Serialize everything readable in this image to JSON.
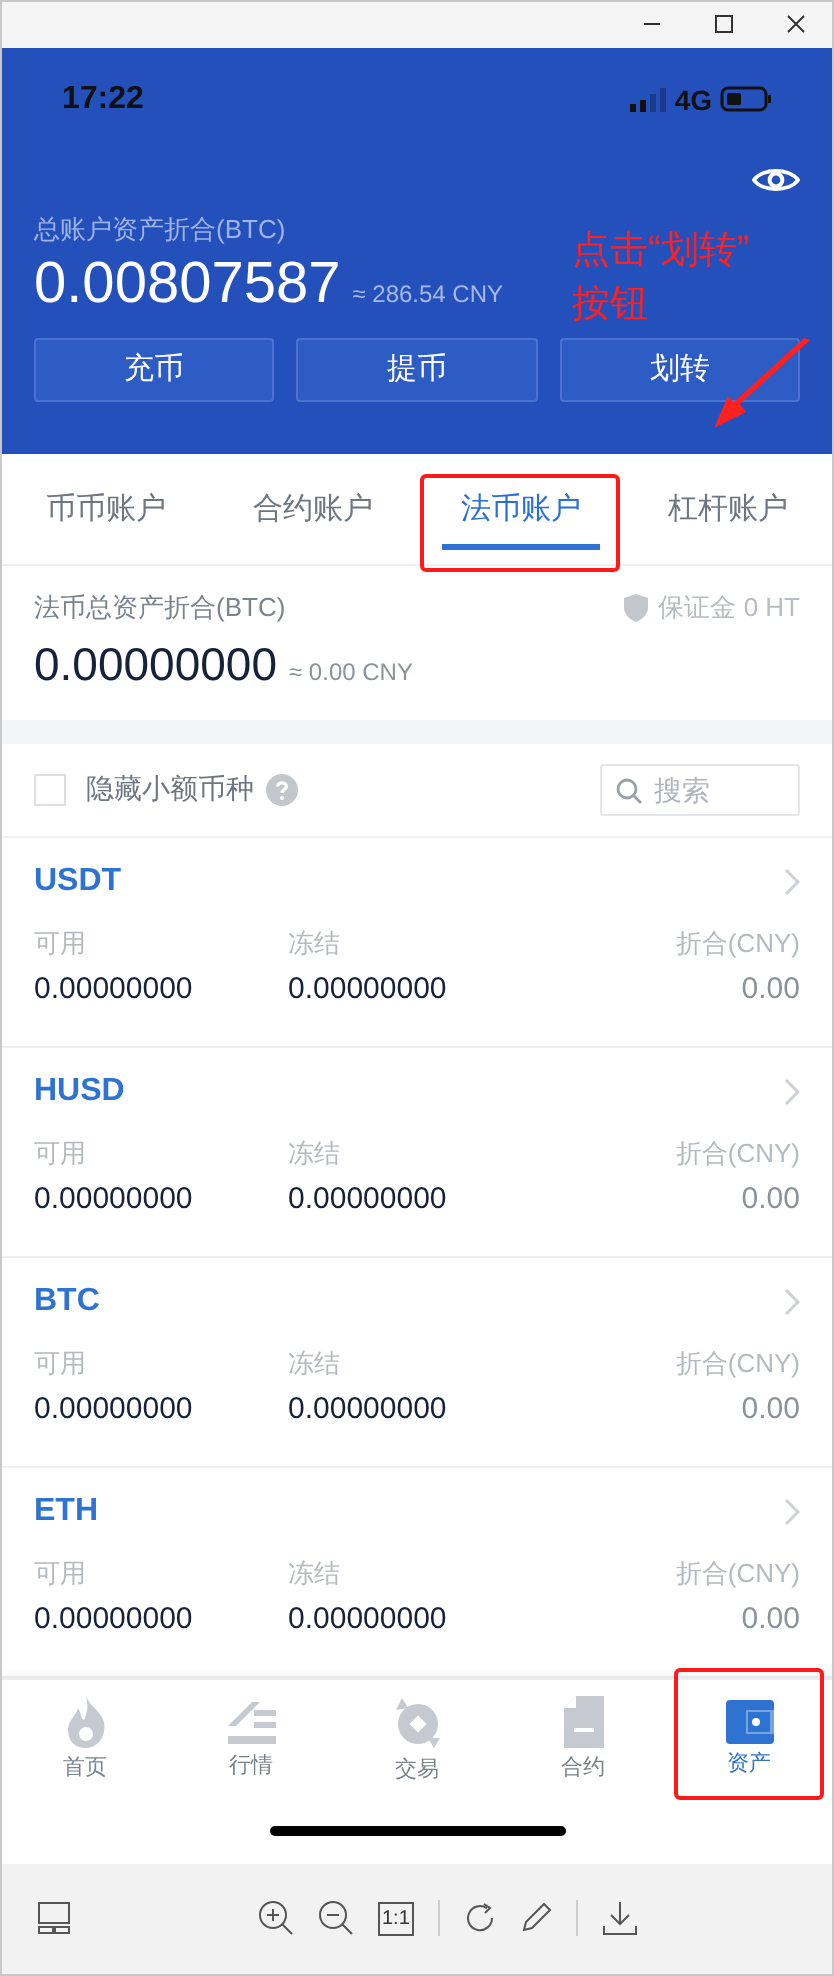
{
  "status_bar": {
    "time": "17:22",
    "network": "4G"
  },
  "header": {
    "total_label": "总账户资产折合(BTC)",
    "total_value": "0.00807587",
    "total_cny": "≈ 286.54 CNY",
    "actions": [
      "充币",
      "提币",
      "划转"
    ]
  },
  "annotation": {
    "lines": [
      "点击“划转”",
      "按钮"
    ]
  },
  "tabs": [
    {
      "label": "币币账户",
      "selected": false
    },
    {
      "label": "合约账户",
      "selected": false
    },
    {
      "label": "法币账户",
      "selected": true,
      "highlighted": true
    },
    {
      "label": "杠杆账户",
      "selected": false
    }
  ],
  "summary": {
    "label": "法币总资产折合(BTC)",
    "deposit": "保证金 0 HT",
    "value": "0.00000000",
    "cny": "≈ 0.00 CNY"
  },
  "filter": {
    "label": "隐藏小额币种",
    "checked": false,
    "search_placeholder": "搜索"
  },
  "coins": [
    {
      "name": "USDT",
      "available_label": "可用",
      "available": "0.00000000",
      "frozen_label": "冻结",
      "frozen": "0.00000000",
      "cny_label": "折合(CNY)",
      "cny": "0.00"
    },
    {
      "name": "HUSD",
      "available_label": "可用",
      "available": "0.00000000",
      "frozen_label": "冻结",
      "frozen": "0.00000000",
      "cny_label": "折合(CNY)",
      "cny": "0.00"
    },
    {
      "name": "BTC",
      "available_label": "可用",
      "available": "0.00000000",
      "frozen_label": "冻结",
      "frozen": "0.00000000",
      "cny_label": "折合(CNY)",
      "cny": "0.00"
    },
    {
      "name": "ETH",
      "available_label": "可用",
      "available": "0.00000000",
      "frozen_label": "冻结",
      "frozen": "0.00000000",
      "cny_label": "折合(CNY)",
      "cny": "0.00"
    }
  ],
  "nav": [
    {
      "label": "首页",
      "kind": "home",
      "selected": false
    },
    {
      "label": "行情",
      "kind": "market",
      "selected": false
    },
    {
      "label": "交易",
      "kind": "trade",
      "selected": false
    },
    {
      "label": "合约",
      "kind": "contract",
      "selected": false
    },
    {
      "label": "资产",
      "kind": "assets",
      "selected": true,
      "highlighted": true
    }
  ],
  "viewer_toolbar": {
    "actual_size": "1:1"
  }
}
